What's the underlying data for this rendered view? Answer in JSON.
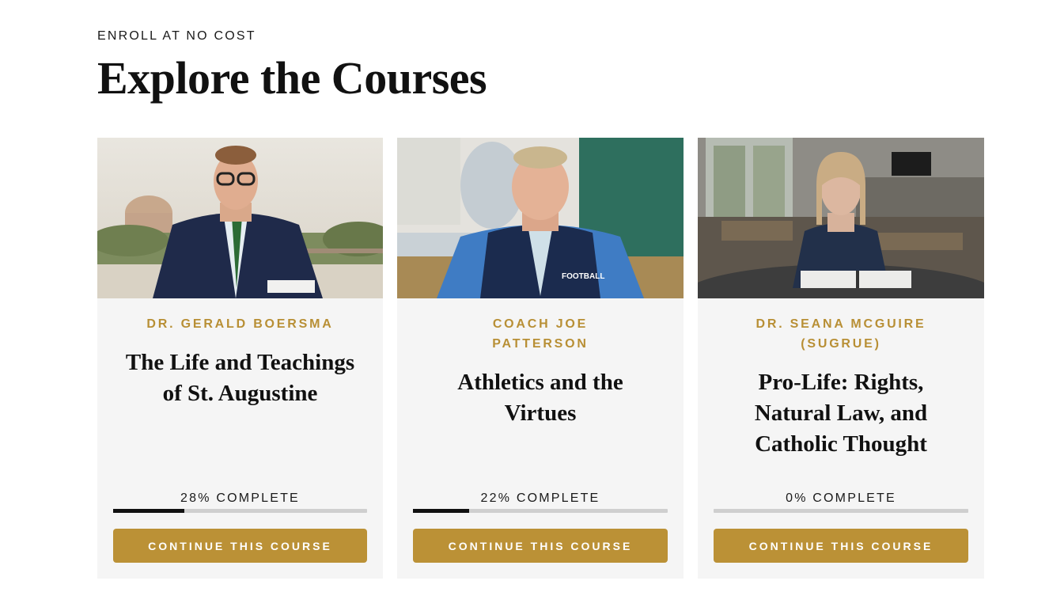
{
  "header": {
    "eyebrow": "ENROLL AT NO COST",
    "title": "Explore the Courses"
  },
  "colors": {
    "accent": "#bb9136",
    "instructor_text": "#b88f35",
    "card_bg": "#f5f5f5",
    "progress_fill": "#111111",
    "progress_track": "#cfcfcf"
  },
  "courses": [
    {
      "instructor": "DR. GERALD BOERSMA",
      "title": "The Life and Teachings of St. Augustine",
      "progress_label": "28% COMPLETE",
      "progress": 0.28,
      "button_label": "CONTINUE THIS COURSE",
      "image": "instructor-photo-outdoor-campus"
    },
    {
      "instructor": "COACH JOE PATTERSON",
      "title": "Athletics and the Virtues",
      "progress_label": "22% COMPLETE",
      "progress": 0.22,
      "button_label": "CONTINUE THIS COURSE",
      "image": "instructor-photo-gymnasium"
    },
    {
      "instructor": "DR. SEANA MCGUIRE (SUGRUE)",
      "title": "Pro-Life: Rights, Natural Law, and Catholic Thought",
      "progress_label": "0% COMPLETE",
      "progress": 0,
      "button_label": "CONTINUE THIS COURSE",
      "image": "instructor-photo-library"
    }
  ]
}
